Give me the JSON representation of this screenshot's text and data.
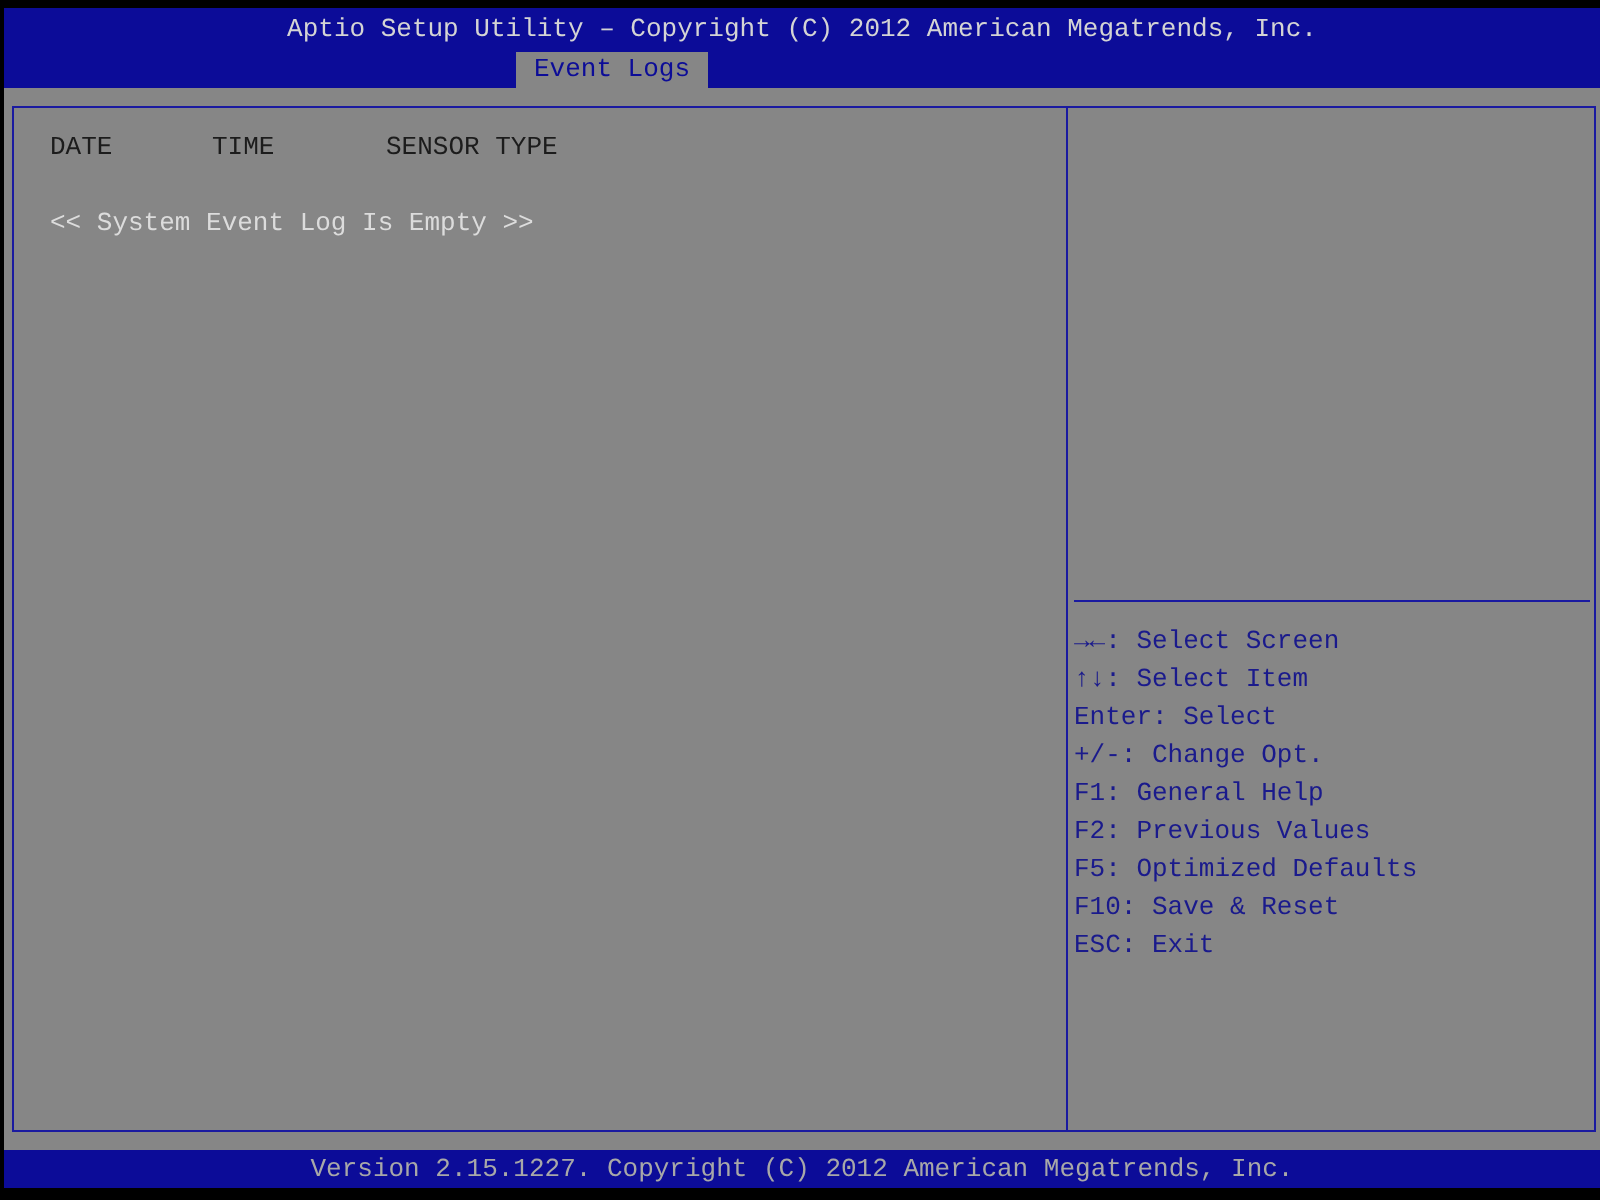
{
  "header": {
    "title": "Aptio Setup Utility – Copyright (C) 2012 American Megatrends, Inc.",
    "tabs": [
      {
        "label": "Event Logs",
        "selected": true
      }
    ]
  },
  "event_log": {
    "columns": [
      "DATE",
      "TIME",
      "SENSOR TYPE"
    ],
    "empty_message": "<< System Event Log Is Empty >>"
  },
  "help": {
    "lines": [
      "**→←**: Select Screen",
      "**↑↓**: Select Item",
      "Enter: Select",
      "+/-: Change Opt.",
      "F1: General Help",
      "F2: Previous Values",
      "F5: Optimized Defaults",
      "F10: Save & Reset",
      "ESC: Exit"
    ]
  },
  "footer": {
    "text": "Version 2.15.1227. Copyright (C) 2012 American Megatrends, Inc."
  }
}
